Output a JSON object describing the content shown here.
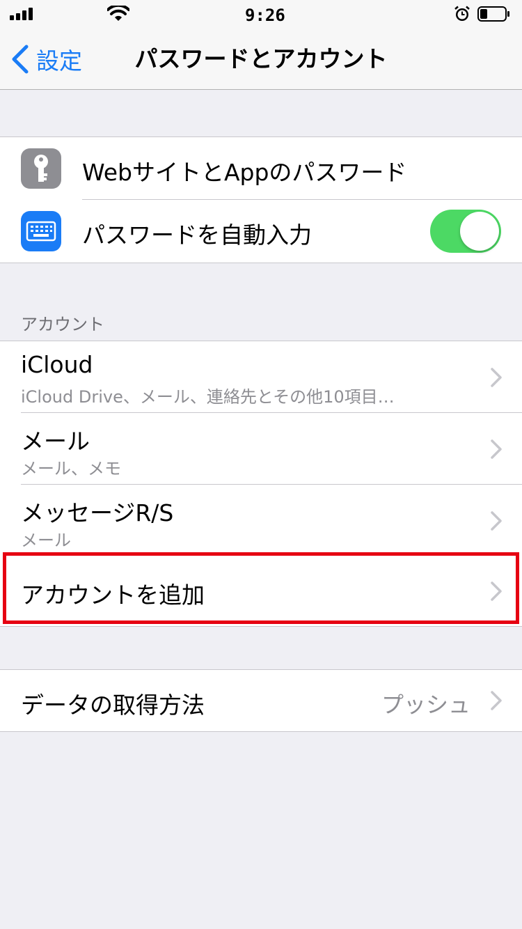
{
  "status_bar": {
    "time": "9:26",
    "icons": [
      "cellular-signal-icon",
      "wifi-icon",
      "alarm-icon",
      "battery-icon"
    ]
  },
  "nav": {
    "back_label": "設定",
    "title": "パスワードとアカウント"
  },
  "passwords_group": {
    "items": [
      {
        "label": "WebサイトとAppのパスワード",
        "icon": "key-icon"
      },
      {
        "label": "パスワードを自動入力",
        "icon": "keyboard-icon",
        "toggle_on": true
      }
    ]
  },
  "accounts_section": {
    "header": "アカウント",
    "items": [
      {
        "title": "iCloud",
        "subtitle": "iCloud Drive、メール、連絡先とその他10項目…"
      },
      {
        "title": "メール",
        "subtitle": "メール、メモ"
      },
      {
        "title": "メッセージR/S",
        "subtitle": "メール"
      },
      {
        "title": "アカウントを追加"
      }
    ]
  },
  "fetch_group": {
    "label": "データの取得方法",
    "value": "プッシュ"
  },
  "colors": {
    "accent": "#1a7cf6",
    "toggle_on": "#4cd964",
    "highlight": "#e60012",
    "background": "#efeff4"
  }
}
